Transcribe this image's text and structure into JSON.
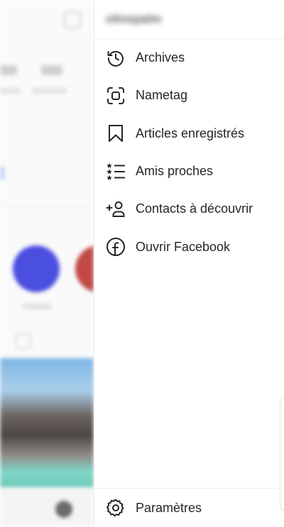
{
  "drawer": {
    "username": "olivepalm",
    "items": [
      {
        "label": "Archives",
        "icon": "archive-clock-icon"
      },
      {
        "label": "Nametag",
        "icon": "nametag-scan-icon"
      },
      {
        "label": "Articles enregistrés",
        "icon": "bookmark-icon"
      },
      {
        "label": "Amis proches",
        "icon": "close-friends-list-icon"
      },
      {
        "label": "Contacts à découvrir",
        "icon": "add-person-icon"
      },
      {
        "label": "Ouvrir Facebook",
        "icon": "facebook-icon"
      }
    ],
    "footer": {
      "label": "Paramètres",
      "icon": "settings-gear-icon"
    }
  },
  "colors": {
    "text": "#262626",
    "divider": "#efefef",
    "background": "#ffffff"
  }
}
